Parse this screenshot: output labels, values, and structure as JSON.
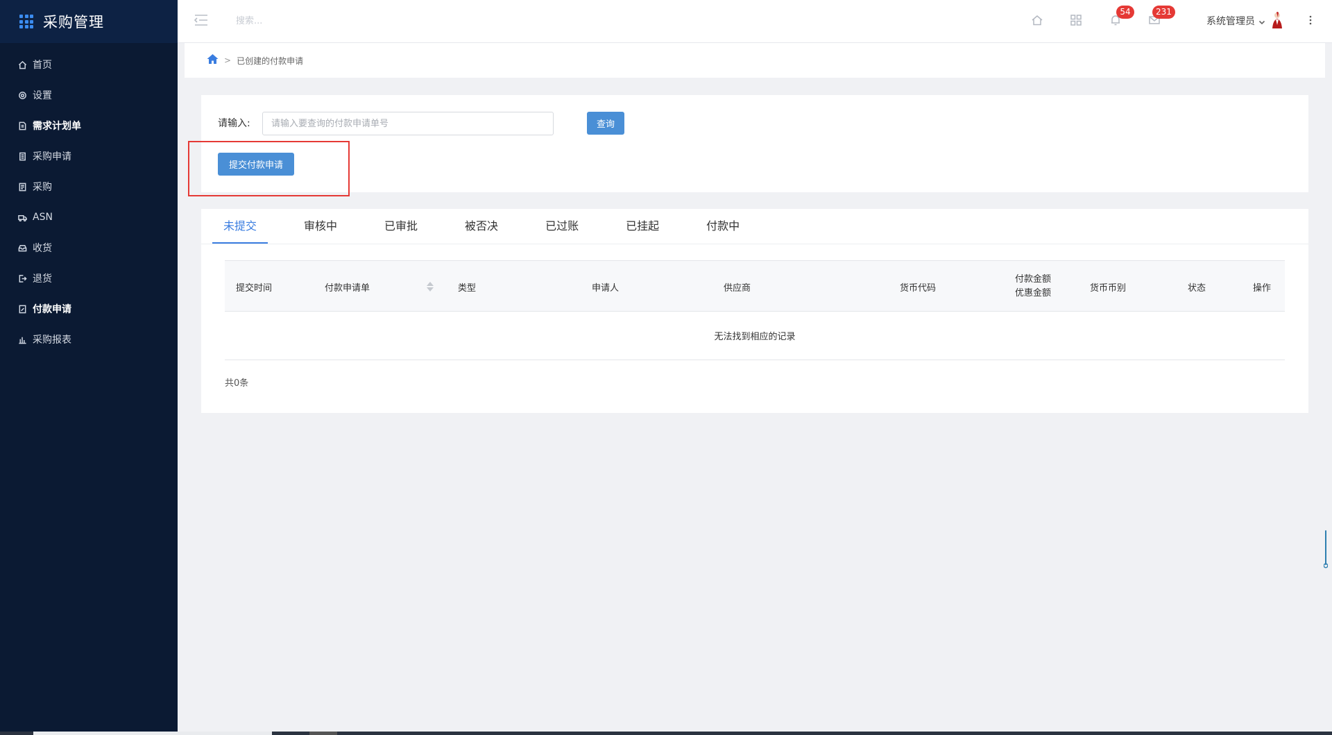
{
  "app": {
    "title": "采购管理"
  },
  "sidebar": {
    "items": [
      {
        "label": "首页",
        "icon": "home-icon",
        "bold": false
      },
      {
        "label": "设置",
        "icon": "gear-icon",
        "bold": false
      },
      {
        "label": "需求计划单",
        "icon": "document-icon",
        "bold": true
      },
      {
        "label": "采购申请",
        "icon": "file-list-icon",
        "bold": false
      },
      {
        "label": "采购",
        "icon": "doc-lines-icon",
        "bold": false
      },
      {
        "label": "ASN",
        "icon": "truck-icon",
        "bold": false
      },
      {
        "label": "收货",
        "icon": "inbox-icon",
        "bold": false
      },
      {
        "label": "退货",
        "icon": "exit-icon",
        "bold": false
      },
      {
        "label": "付款申请",
        "icon": "doc-edit-icon",
        "bold": true
      },
      {
        "label": "采购报表",
        "icon": "bar-chart-icon",
        "bold": false
      }
    ]
  },
  "topbar": {
    "search_placeholder": "搜索...",
    "notifications_count": "54",
    "messages_count": "231",
    "user_name": "系统管理员"
  },
  "breadcrumb": {
    "current": "已创建的付款申请",
    "separator": ">"
  },
  "query": {
    "label": "请输入:",
    "placeholder": "请输入要查询的付款申请单号",
    "value": "",
    "search_button": "查询",
    "submit_button": "提交付款申请"
  },
  "tabs": [
    {
      "label": "未提交",
      "active": true
    },
    {
      "label": "审核中",
      "active": false
    },
    {
      "label": "已审批",
      "active": false
    },
    {
      "label": "被否决",
      "active": false
    },
    {
      "label": "已过账",
      "active": false
    },
    {
      "label": "已挂起",
      "active": false
    },
    {
      "label": "付款中",
      "active": false
    }
  ],
  "table": {
    "columns": [
      "提交时间",
      "付款申请单",
      "类型",
      "申请人",
      "供应商",
      "货币代码",
      "付款金额",
      "优惠金额",
      "货币币别",
      "状态",
      "操作"
    ],
    "empty_text": "无法找到相应的记录",
    "total_text": "共0条"
  },
  "colors": {
    "sidebar_bg": "#0b1a33",
    "accent": "#3a7de0",
    "button": "#4a8fd6",
    "badge": "#e53935",
    "highlight_border": "#e53935"
  }
}
